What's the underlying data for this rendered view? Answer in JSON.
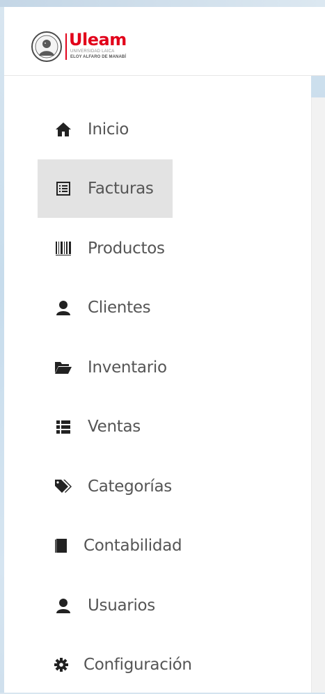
{
  "brand": {
    "name": "Uleam",
    "subtitle_line1": "UNIVERSIDAD LAICA",
    "subtitle_line2": "ELOY ALFARO DE MANABÍ"
  },
  "colors": {
    "brand_red": "#e2001a",
    "menu_text": "#555555",
    "active_bg": "#e3e3e3"
  },
  "sidebar": {
    "active": "Facturas",
    "items": [
      {
        "label": "Inicio",
        "icon": "home-icon"
      },
      {
        "label": "Facturas",
        "icon": "list-alt-icon"
      },
      {
        "label": "Productos",
        "icon": "barcode-icon"
      },
      {
        "label": "Clientes",
        "icon": "user-icon"
      },
      {
        "label": "Inventario",
        "icon": "folder-open-icon"
      },
      {
        "label": "Ventas",
        "icon": "th-list-icon"
      },
      {
        "label": "Categorías",
        "icon": "tags-icon"
      },
      {
        "label": "Contabilidad",
        "icon": "book-icon"
      },
      {
        "label": "Usuarios",
        "icon": "user-icon"
      },
      {
        "label": "Configuración",
        "icon": "cog-icon"
      }
    ]
  }
}
